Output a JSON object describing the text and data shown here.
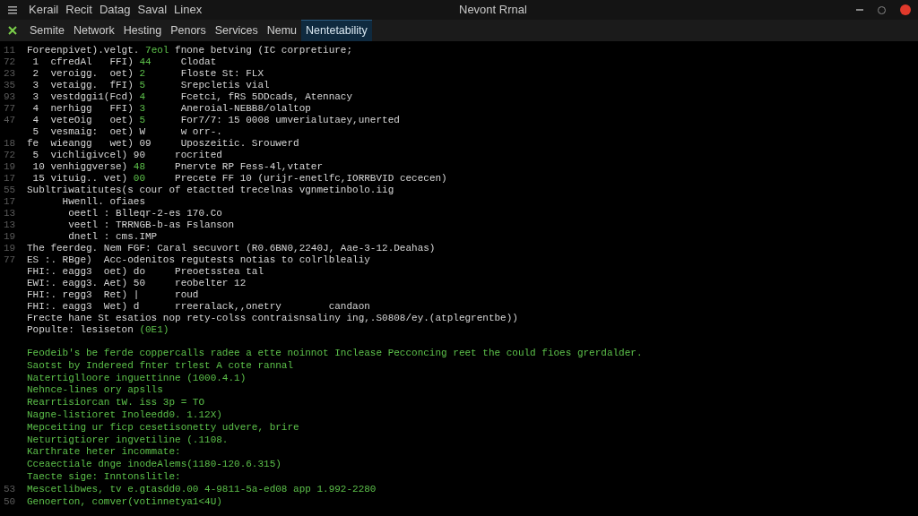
{
  "window": {
    "menu": [
      "Kerail",
      "Recit",
      "Datag",
      "Saval",
      "Linex"
    ],
    "title": "Nevont Rrnal"
  },
  "tabs": [
    {
      "label": "Semite",
      "selected": false
    },
    {
      "label": "Network",
      "selected": false
    },
    {
      "label": "Hesting",
      "selected": false
    },
    {
      "label": "Penors",
      "selected": false
    },
    {
      "label": "Services",
      "selected": false
    },
    {
      "label": "Nemu",
      "selected": false
    },
    {
      "label": "Nentetability",
      "selected": true
    }
  ],
  "output": [
    {
      "gutter": "11",
      "segments": [
        {
          "text": "Foreenpivet).velgt. ",
          "kind": "plain"
        },
        {
          "text": "7eol",
          "kind": "green"
        },
        {
          "text": " fnone betving (IC corpretiure;",
          "kind": "plain"
        }
      ]
    },
    {
      "gutter": "72",
      "segments": [
        {
          "text": " 1  cfredAl   FFI) ",
          "kind": "plain"
        },
        {
          "text": "44",
          "kind": "green"
        },
        {
          "text": "     Clodat",
          "kind": "plain"
        }
      ]
    },
    {
      "gutter": "23",
      "segments": [
        {
          "text": " 2  veroigg.  oet) ",
          "kind": "plain"
        },
        {
          "text": "2",
          "kind": "green"
        },
        {
          "text": "      Floste St: FLX",
          "kind": "plain"
        }
      ]
    },
    {
      "gutter": "35",
      "segments": [
        {
          "text": " 3  vetaigg.  fFI) ",
          "kind": "plain"
        },
        {
          "text": "5",
          "kind": "green"
        },
        {
          "text": "      Srepcletis vial",
          "kind": "plain"
        }
      ]
    },
    {
      "gutter": "93",
      "segments": [
        {
          "text": " 3  vestdggi1(Fcd) ",
          "kind": "plain"
        },
        {
          "text": "4",
          "kind": "green"
        },
        {
          "text": "      Fcetci, fRS 5DDcads, Atennacy",
          "kind": "plain"
        }
      ]
    },
    {
      "gutter": "77",
      "segments": [
        {
          "text": " 4  nerhigg   FFI) ",
          "kind": "plain"
        },
        {
          "text": "3",
          "kind": "green"
        },
        {
          "text": "      Aneroial-NEBB8/olaltop",
          "kind": "plain"
        }
      ]
    },
    {
      "gutter": "47",
      "segments": [
        {
          "text": " 4  veteOig   oet) ",
          "kind": "plain"
        },
        {
          "text": "5",
          "kind": "green"
        },
        {
          "text": "      For7/7: 15 0008 umverialutaey,unerted",
          "kind": "plain"
        }
      ]
    },
    {
      "segments": [
        {
          "text": " 5  vesmaig:  oet) W      w orr-.",
          "kind": "plain"
        }
      ]
    },
    {
      "gutter": "18",
      "segments": [
        {
          "text": "fe  wieangg   wet) 09     Uposzeitic. Srouwerd",
          "kind": "plain"
        }
      ]
    },
    {
      "gutter": "72",
      "segments": [
        {
          "text": " 5  vichligivcel) 90     rocrited",
          "kind": "plain"
        }
      ]
    },
    {
      "gutter": "19",
      "segments": [
        {
          "text": " 10 venhiggverse) ",
          "kind": "plain"
        },
        {
          "text": "48",
          "kind": "green"
        },
        {
          "text": "     Pnervte RP Fess-4l,vtater",
          "kind": "plain"
        }
      ]
    },
    {
      "gutter": "17",
      "segments": [
        {
          "text": " 15 vituig.. vet) ",
          "kind": "plain"
        },
        {
          "text": "00",
          "kind": "green"
        },
        {
          "text": "     Precete FF 10 (urijr-enetlfc,IORRBVID cececen)",
          "kind": "plain"
        }
      ]
    },
    {
      "gutter": "55",
      "segments": [
        {
          "text": "Subltriwatitutes(s cour of etactted trecelnas vgnmetinbolo.iig",
          "kind": "plain"
        }
      ]
    },
    {
      "gutter": "17",
      "segments": [
        {
          "text": "      Hwenll. ofiaes",
          "kind": "plain"
        }
      ]
    },
    {
      "gutter": "13",
      "segments": [
        {
          "text": "       oeetl : Blleqr-2-es 170.Co",
          "kind": "plain"
        }
      ]
    },
    {
      "gutter": "13",
      "segments": [
        {
          "text": "       veetl : TRRNGB-b-as Fslanson",
          "kind": "plain"
        }
      ]
    },
    {
      "gutter": "19",
      "segments": [
        {
          "text": "       dnetl : cms.IMP",
          "kind": "plain"
        }
      ]
    },
    {
      "gutter": "19",
      "segments": [
        {
          "text": "The feerdeg. Nem FGF: Caral secuvort (R0.6BN0,2240J, Aae-3-12.Deahas)",
          "kind": "plain"
        }
      ]
    },
    {
      "gutter": "77",
      "segments": [
        {
          "text": "ES :. RBge)  Acc-odenitos regutests notias to colrlblealiy",
          "kind": "plain"
        }
      ]
    },
    {
      "segments": [
        {
          "text": "FHI:. eagg3  oet) do     Preoetsstea tal",
          "kind": "plain"
        }
      ]
    },
    {
      "segments": [
        {
          "text": "EWI:. eagg3. Aet) 50     reobelter 12",
          "kind": "plain"
        }
      ]
    },
    {
      "segments": [
        {
          "text": "FHI:. regg3  Ret) |      roud",
          "kind": "plain"
        }
      ]
    },
    {
      "segments": [
        {
          "text": "FHI:. eagg3  Wet) d      rreeralack,,onetry        candaon",
          "kind": "plain"
        }
      ]
    },
    {
      "segments": [
        {
          "text": "Frecte hane St esatios nop rety-colss contraisnsaliny ing,.S0808/ey.(atplegrentbe))",
          "kind": "plain"
        }
      ]
    },
    {
      "segments": [
        {
          "text": "Populte: lesiseton ",
          "kind": "plain"
        },
        {
          "text": "(0E1)",
          "kind": "green"
        }
      ]
    }
  ],
  "log": [
    {
      "text": "Feodeib's be ferde coppercalls radee a ette noinnot Inclease Pecconcing reet the could fioes grerdalder."
    },
    {
      "text": "Saotst by Indereed fnter trlest A cote rannal"
    },
    {
      "text": "Natertiglloore inguettinne (1000.4.1)"
    },
    {
      "text": "Nehnce-lines ory apslls"
    },
    {
      "text": "Rearrtisiorcan tW. iss 3p = TO"
    },
    {
      "text": "Nagne-listioret Inoleedd0. 1.12X)"
    },
    {
      "text": "Mepceiting ur ficp cesetisonetty udvere, brire"
    },
    {
      "text": "Neturtigtiorer ingvetiline (.1108."
    },
    {
      "text": "Karthrate heter incommate:"
    },
    {
      "text": "Cceaectiale dnge inodeAlems(1180-120.6.315)"
    },
    {
      "text": "Taecte sige: Inntonslitle:"
    },
    {
      "gutter": "53",
      "text": "Mescetlibwes, tv e.gtasdd0.00 4-9811-5a-ed08 app 1.992-2280"
    },
    {
      "gutter": "50",
      "text": "Genoerton, comver(votinnetya1<4U)"
    }
  ]
}
